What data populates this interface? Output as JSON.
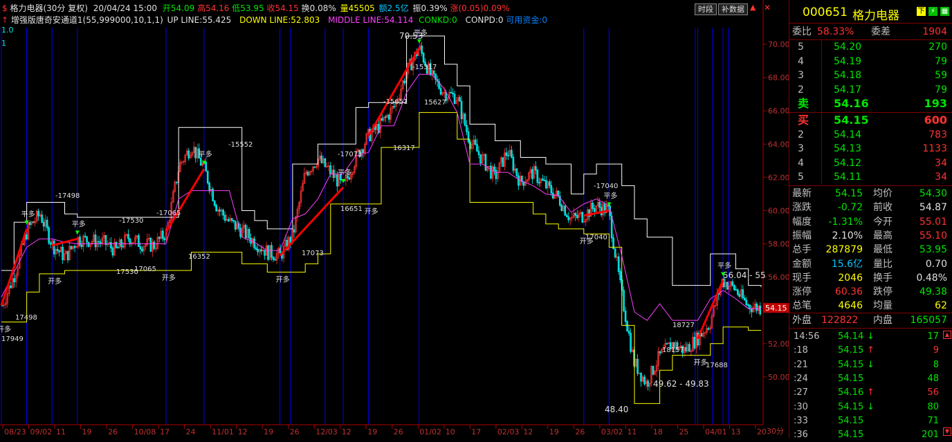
{
  "header": {
    "name": "格力电器(30分 复权)",
    "date": "20/04/24 15:00",
    "open": "开54.09",
    "high": "高54.16",
    "low": "低53.95",
    "close": "收54.15",
    "turnover": "换0.08%",
    "volume": "量45505",
    "amount": "额2.5亿",
    "amplitude": "振0.39%",
    "change": "涨(0.05)0.09%"
  },
  "toolbar": {
    "time_btn": "时段",
    "fill_btn": "补数据"
  },
  "indicator": {
    "name": "增强版唐奇安通道1(55,999000,10,1,1)",
    "up": "UP LINE:55.425",
    "down": "DOWN LINE:52.803",
    "middle": "MIDDLE LINE:54.114",
    "conkd": "CONKD:0",
    "conpd": "CONPD:0",
    "avail": "可用资金:0"
  },
  "left_labels": {
    "a": "1.0",
    "b": "1"
  },
  "price_axis": {
    "ticks": [
      "70.00",
      "68.00",
      "66.00",
      "64.00",
      "62.00",
      "60.00",
      "58.00",
      "56.00",
      "54.00",
      "52.00",
      "50.00"
    ],
    "current": "54.15",
    "period": "30分"
  },
  "date_axis": [
    "08/23",
    "09/02",
    "11",
    "19",
    "26",
    "10/08",
    "17",
    "24",
    "11/01",
    "12",
    "19",
    "26",
    "12/03",
    "12",
    "19",
    "26",
    "01/02",
    "10",
    "17",
    "02/03",
    "12",
    "19",
    "26",
    "03/02",
    "11",
    "18",
    "25",
    "04/01",
    "13",
    "20"
  ],
  "annotations": [
    "70.53",
    "48.40",
    "49.62 - 49.83",
    "56.04 - 55",
    "-17498",
    "-17530",
    "-17065",
    "-15552",
    "-17073",
    "-15651",
    "-15317",
    "-17040",
    "17949",
    "17498",
    "17530",
    "17065",
    "16352",
    "17073",
    "16651",
    "16317",
    "15627",
    "17040",
    "18727",
    "18157",
    "17688",
    "开多",
    "平多"
  ],
  "chart_data": {
    "type": "candlestick",
    "ylim": [
      47.5,
      71
    ],
    "close_path": [
      54.3,
      56.2,
      58.9,
      59.8,
      57.9,
      57.2,
      58.3,
      58.2,
      58.1,
      57.6,
      58.4,
      58.0,
      57.9,
      58.7,
      62.7,
      63.9,
      62.5,
      60.2,
      59.3,
      58.8,
      58.1,
      57.5,
      57.3,
      58.5,
      62.3,
      63.1,
      62.3,
      61.4,
      63.2,
      64.5,
      65.2,
      66.2,
      68.3,
      69.8,
      68.0,
      67.1,
      66.8,
      64.2,
      63.1,
      62.0,
      63.6,
      61.7,
      62.3,
      61.5,
      60.8,
      59.5,
      59.7,
      60.3,
      60.0,
      55.1,
      50.9,
      49.6,
      51.2,
      52.0,
      51.6,
      52.3,
      53.2,
      55.8,
      55.3,
      54.3,
      54.15
    ],
    "up_line": [
      56.4,
      59.3,
      60.5,
      60.5,
      60.5,
      59.8,
      59.6,
      59.6,
      59.6,
      59.6,
      59.6,
      59.6,
      59.6,
      59.6,
      65.0,
      65.0,
      65.0,
      65.0,
      65.0,
      60.0,
      59.4,
      58.9,
      58.9,
      62.8,
      62.8,
      64.0,
      64.0,
      64.0,
      66.2,
      66.5,
      66.5,
      66.5,
      70.5,
      70.5,
      70.5,
      68.8,
      67.5,
      65.2,
      65.2,
      64.2,
      64.2,
      63.2,
      63.2,
      62.8,
      62.8,
      61.0,
      62.2,
      62.8,
      62.8,
      61.5,
      59.5,
      58.4,
      58.4,
      55.5,
      55.5,
      55.5,
      57.4,
      57.4,
      56.5,
      55.5,
      55.4
    ],
    "down_line": [
      53.3,
      53.3,
      55.1,
      56.2,
      56.2,
      56.4,
      56.4,
      56.4,
      56.4,
      56.4,
      56.4,
      56.4,
      56.4,
      56.4,
      56.4,
      57.5,
      57.5,
      57.5,
      57.5,
      56.8,
      56.8,
      56.3,
      56.3,
      56.3,
      56.8,
      57.4,
      60.4,
      60.4,
      60.4,
      60.4,
      63.8,
      63.8,
      63.8,
      65.9,
      65.9,
      65.9,
      64.3,
      60.5,
      60.5,
      60.5,
      60.5,
      60.5,
      59.8,
      59.2,
      58.9,
      58.9,
      58.6,
      58.6,
      57.8,
      53.1,
      48.4,
      48.4,
      50.4,
      51.3,
      51.3,
      51.3,
      52.0,
      53.0,
      53.0,
      52.8,
      52.8
    ],
    "middle_line": [
      54.8,
      56.3,
      57.8,
      58.3,
      58.3,
      58.1,
      58.0,
      58.0,
      58.0,
      58.0,
      58.0,
      58.0,
      58.0,
      58.0,
      60.7,
      61.2,
      61.2,
      61.2,
      61.2,
      58.4,
      58.1,
      57.6,
      57.6,
      59.5,
      59.8,
      60.7,
      62.2,
      62.2,
      63.3,
      63.5,
      65.1,
      65.1,
      67.1,
      68.2,
      68.2,
      67.3,
      65.9,
      62.8,
      62.8,
      62.3,
      62.3,
      61.8,
      61.5,
      61.0,
      60.9,
      59.9,
      60.4,
      60.7,
      60.3,
      57.3,
      53.9,
      53.4,
      54.4,
      53.4,
      53.4,
      53.4,
      54.7,
      55.2,
      54.7,
      54.1,
      54.1
    ],
    "signal_segments": [
      [
        0,
        2
      ],
      [
        4,
        6
      ],
      [
        13,
        16
      ],
      [
        22,
        27
      ],
      [
        29,
        33
      ],
      [
        46,
        48
      ],
      [
        55,
        57
      ]
    ]
  },
  "quote": {
    "code": "000651",
    "name": "格力电器",
    "ratio_label": "委比",
    "ratio": "58.33%",
    "diff_label": "委差",
    "diff": "1904",
    "asks": [
      [
        "5",
        "54.20",
        "270"
      ],
      [
        "4",
        "54.19",
        "79"
      ],
      [
        "3",
        "54.18",
        "59"
      ],
      [
        "2",
        "54.17",
        "79"
      ],
      [
        "卖",
        "54.16",
        "193"
      ]
    ],
    "bids": [
      [
        "买",
        "54.15",
        "600"
      ],
      [
        "2",
        "54.14",
        "783"
      ],
      [
        "3",
        "54.13",
        "1133"
      ],
      [
        "4",
        "54.12",
        "34"
      ],
      [
        "5",
        "54.11",
        "34"
      ]
    ],
    "stats": [
      [
        "最新",
        "54.15",
        "均价",
        "54.30"
      ],
      [
        "涨跌",
        "-0.72",
        "前收",
        "54.87"
      ],
      [
        "幅度",
        "-1.31%",
        "今开",
        "55.01"
      ],
      [
        "振幅",
        "2.10%",
        "最高",
        "55.10"
      ],
      [
        "总手",
        "287879",
        "最低",
        "53.95"
      ],
      [
        "金额",
        "15.6亿",
        "量比",
        "0.70"
      ],
      [
        "现手",
        "2046",
        "换手",
        "0.48%"
      ],
      [
        "涨停",
        "60.36",
        "跌停",
        "49.38"
      ],
      [
        "总笔",
        "4646",
        "均量",
        "62"
      ]
    ],
    "outer_label": "外盘",
    "outer": "122822",
    "inner_label": "内盘",
    "inner": "165057"
  },
  "ticks": [
    [
      "14:56",
      "54.14",
      "↓",
      "17"
    ],
    [
      ":18",
      "54.15",
      "↑",
      "9"
    ],
    [
      ":21",
      "54.15",
      "↓",
      "8"
    ],
    [
      ":24",
      "54.15",
      "",
      "48"
    ],
    [
      ":27",
      "54.16",
      "↑",
      "56"
    ],
    [
      ":30",
      "54.15",
      "↓",
      "80"
    ],
    [
      ":33",
      "54.15",
      "",
      "71"
    ],
    [
      ":36",
      "54.15",
      "",
      "201"
    ]
  ]
}
